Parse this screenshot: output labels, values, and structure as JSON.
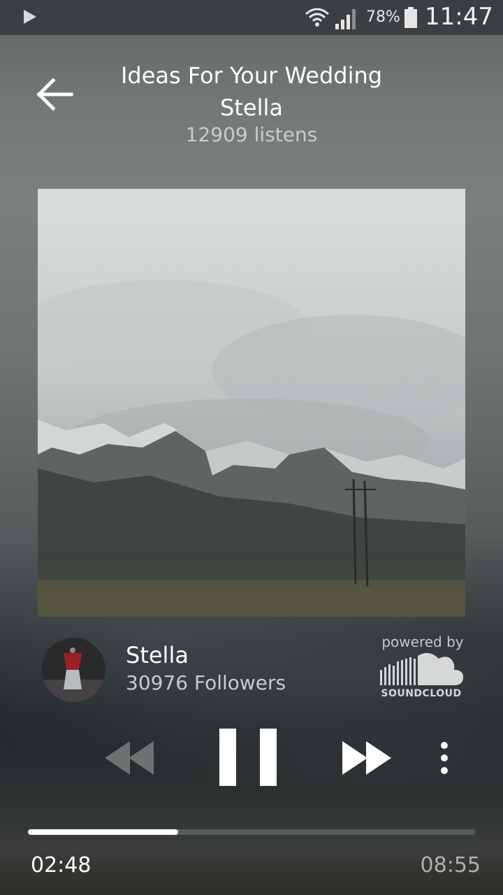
{
  "status_bar": {
    "battery": "78%",
    "time": "11:47"
  },
  "header": {
    "title": "Ideas For Your Wedding",
    "artist": "Stella",
    "listens": "12909 listens"
  },
  "user": {
    "name": "Stella",
    "followers": "30976 Followers"
  },
  "branding": {
    "powered_by": "powered by",
    "service": "SOUNDCLOUD"
  },
  "player": {
    "current_time": "02:48",
    "total_time": "08:55",
    "progress": 0.336,
    "state": "playing"
  },
  "icons": [
    "play-indicator-icon",
    "wifi-icon",
    "signal-icon",
    "battery-icon",
    "back-arrow-icon",
    "soundcloud-logo-icon",
    "rewind-icon",
    "pause-icon",
    "fast-forward-icon",
    "more-vertical-icon"
  ]
}
